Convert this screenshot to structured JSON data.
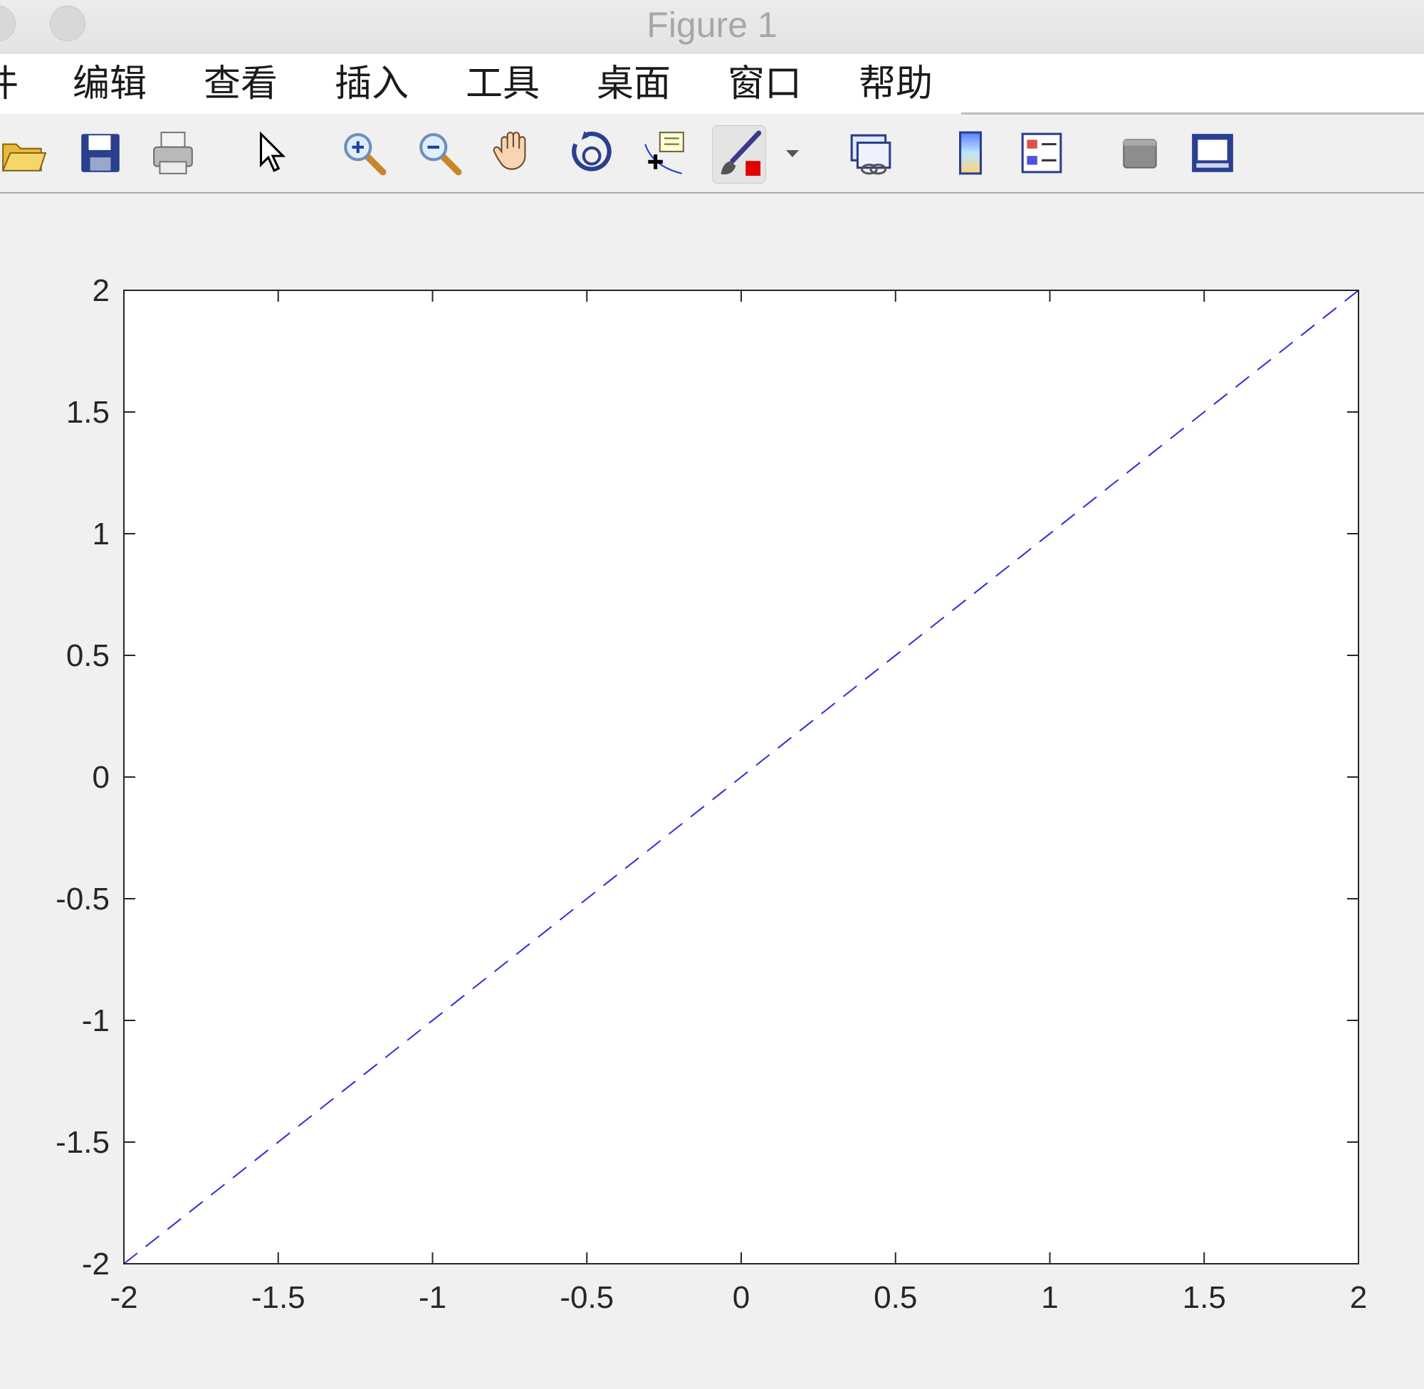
{
  "window": {
    "title": "Figure 1"
  },
  "menubar": {
    "items": [
      {
        "label": "件"
      },
      {
        "label": "编辑"
      },
      {
        "label": "查看"
      },
      {
        "label": "插入"
      },
      {
        "label": "工具"
      },
      {
        "label": "桌面"
      },
      {
        "label": "窗口"
      },
      {
        "label": "帮助"
      }
    ]
  },
  "toolbar": {
    "tools": [
      "open-file-icon",
      "save-icon",
      "print-icon",
      "pointer-icon",
      "zoom-in-icon",
      "zoom-out-icon",
      "pan-icon",
      "rotate-3d-icon",
      "data-cursor-icon",
      "brush-icon",
      "brush-dropdown-icon",
      "link-plot-icon",
      "colorbar-icon",
      "legend-icon",
      "hide-plot-tools-icon",
      "show-plot-tools-icon"
    ],
    "colors": {
      "accent_red": "#e00000",
      "icon_blue": "#2b3f8f"
    }
  },
  "chart_data": {
    "type": "line",
    "title": "",
    "xlabel": "",
    "ylabel": "",
    "xlim": [
      -2,
      2
    ],
    "ylim": [
      -2,
      2
    ],
    "xticks": [
      -2,
      -1.5,
      -1,
      -0.5,
      0,
      0.5,
      1,
      1.5,
      2
    ],
    "yticks": [
      -2,
      -1.5,
      -1,
      -0.5,
      0,
      0.5,
      1,
      1.5,
      2
    ],
    "xtick_labels": [
      "-2",
      "-1.5",
      "-1",
      "-0.5",
      "0",
      "0.5",
      "1",
      "1.5",
      "2"
    ],
    "ytick_labels": [
      "-2",
      "-1.5",
      "-1",
      "-0.5",
      "0",
      "0.5",
      "1",
      "1.5",
      "2"
    ],
    "grid": false,
    "series": [
      {
        "x": [
          -2,
          2
        ],
        "y": [
          -2,
          2
        ],
        "color": "#2b2bd9",
        "linestyle": "dashed"
      }
    ]
  }
}
